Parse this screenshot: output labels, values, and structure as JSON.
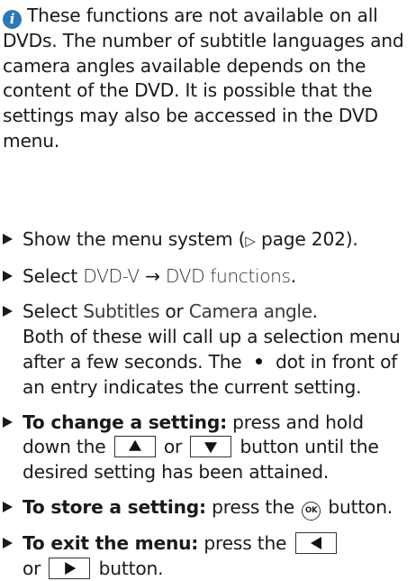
{
  "info": {
    "icon": "info-icon",
    "icon_glyph": "i",
    "text": "These functions are not available on all DVDs. The number of subtitle languages and camera angles available depends on the content of the DVD. It is possible that the settings may also be accessed in the DVD menu."
  },
  "steps": [
    {
      "text1": "Show the menu system (",
      "pointer": "▷",
      "page_ref": " page 202).",
      "text2": ""
    },
    {
      "select": "Select ",
      "menu_a": "DVD-V",
      "arrow": "→",
      "menu_b": "DVD functions",
      "period": "."
    },
    {
      "select": "Select ",
      "option_a": "Subtitles",
      "or": " or ",
      "option_b": "Camera angle",
      "period": ".",
      "body_a": "Both of these will call up a selection menu after a few seconds. The ",
      "body_b": " dot in front of an entry indicates the current setting."
    },
    {
      "bold": "To change a setting:",
      "text_a": " press and hold down the ",
      "or": " or ",
      "text_b": " button until the desired setting has been attained.",
      "key_up": "up-arrow-key",
      "key_down": "down-arrow-key"
    },
    {
      "bold": "To store a setting:",
      "text_a": " press the ",
      "ok_label": "OK",
      "text_b": " button."
    },
    {
      "bold": "To exit the menu:",
      "text_a": " press the ",
      "or": "or ",
      "text_b": " button.",
      "key_left": "left-arrow-key",
      "key_right": "right-arrow-key"
    }
  ],
  "colors": {
    "info_icon": "#2b78b5",
    "text": "#1a1a1a"
  }
}
